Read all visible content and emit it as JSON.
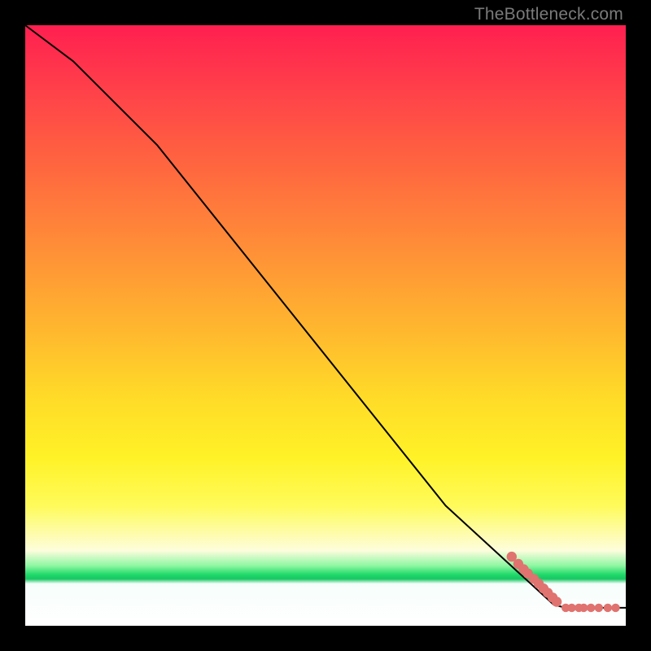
{
  "watermark": "TheBottleneck.com",
  "chart_data": {
    "type": "line",
    "title": "",
    "xlabel": "",
    "ylabel": "",
    "xlim": [
      0,
      100
    ],
    "ylim": [
      0,
      100
    ],
    "grid": false,
    "legend": false,
    "series": [
      {
        "name": "curve",
        "kind": "line",
        "x": [
          0,
          8,
          22,
          70,
          88,
          90,
          100
        ],
        "y": [
          100,
          94,
          80,
          20,
          3.5,
          3,
          3
        ]
      },
      {
        "name": "points-on-slope",
        "kind": "scatter",
        "x": [
          81.0,
          82.1,
          83.0,
          83.7,
          84.7,
          85.5,
          86.3,
          87.0,
          87.8,
          88.5
        ],
        "y": [
          11.5,
          10.3,
          9.4,
          8.7,
          7.8,
          7.0,
          6.2,
          5.5,
          4.7,
          4.0
        ]
      },
      {
        "name": "points-on-flat",
        "kind": "scatter",
        "x": [
          90.0,
          91.0,
          92.2,
          93.0,
          94.2,
          95.5,
          97.0,
          98.3
        ],
        "y": [
          3.0,
          3.0,
          3.0,
          3.0,
          3.0,
          3.0,
          3.0,
          3.0
        ]
      }
    ]
  }
}
